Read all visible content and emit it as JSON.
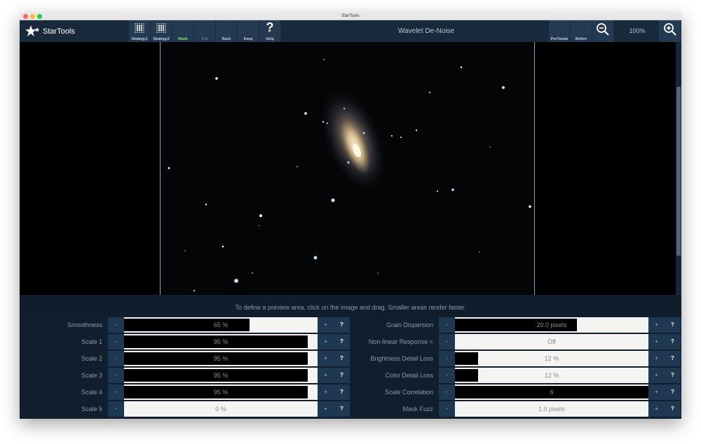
{
  "window": {
    "title": "StarTools"
  },
  "toolbar": {
    "logo_text": "StarTools",
    "buttons_left": [
      {
        "label": "Strategy1",
        "icon": "grid-dots-icon",
        "state": "normal"
      },
      {
        "label": "Strategy2",
        "icon": "grid-dots-icon",
        "state": "normal"
      },
      {
        "label": "Mask",
        "icon": "",
        "state": "mask"
      },
      {
        "label": "Full",
        "icon": "",
        "state": "dim"
      },
      {
        "label": "Back",
        "icon": "",
        "state": "normal"
      },
      {
        "label": "Keep",
        "icon": "",
        "state": "normal"
      },
      {
        "label": "Help",
        "icon": "question-mark-icon",
        "state": "normal"
      }
    ],
    "module_title": "Wavelet De-Noise",
    "buttons_right": [
      {
        "label": "PreTweak"
      },
      {
        "label": "Before"
      }
    ],
    "zoom_level": "100%",
    "colors": {
      "mask_label": "#7fe36a",
      "toolbar_bg": "#18293b",
      "button_bg": "#243a52"
    }
  },
  "hint": "To define a preview area, click on the image and drag. Smaller areas render faster.",
  "params": {
    "minus_label": "-",
    "plus_label": "+",
    "help_label": "?",
    "left": [
      {
        "label": "Smoothness",
        "value": "65 %",
        "fill": 0.65
      },
      {
        "label": "Scale 1",
        "value": "95 %",
        "fill": 0.95
      },
      {
        "label": "Scale 2",
        "value": "95 %",
        "fill": 0.95
      },
      {
        "label": "Scale 3",
        "value": "95 %",
        "fill": 0.95
      },
      {
        "label": "Scale 4",
        "value": "95 %",
        "fill": 0.95
      },
      {
        "label": "Scale 5",
        "value": "0 %",
        "fill": 0.0
      }
    ],
    "right": [
      {
        "label": "Grain Dispersion",
        "value": "20.0 pixels",
        "fill": 0.63
      },
      {
        "label": "Non-linear Response <",
        "value": "Off",
        "fill": 0.0
      },
      {
        "label": "Brightness Detail Loss",
        "value": "12 %",
        "fill": 0.12
      },
      {
        "label": "Color Detail Loss",
        "value": "12 %",
        "fill": 0.12
      },
      {
        "label": "Scale Correlation",
        "value": "6",
        "fill": 1.0
      },
      {
        "label": "Mask Fuzz",
        "value": "1.0 pixels",
        "fill": 0.0
      }
    ]
  }
}
